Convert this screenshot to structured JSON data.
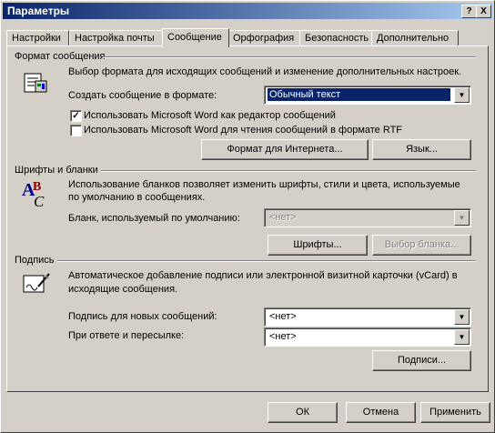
{
  "window": {
    "title": "Параметры",
    "help_button": "?",
    "close_button": "X"
  },
  "tabs": [
    {
      "label": "Настройки"
    },
    {
      "label": "Настройка почты"
    },
    {
      "label": "Сообщение"
    },
    {
      "label": "Орфография"
    },
    {
      "label": "Безопасность"
    },
    {
      "label": "Дополнительно"
    }
  ],
  "active_tab": "Сообщение",
  "format": {
    "header": "Формат сообщения",
    "description": "Выбор формата для исходящих сообщений и изменение дополнительных настроек.",
    "create_label": "Создать сообщение в формате:",
    "create_value": "Обычный текст",
    "use_word_editor": {
      "label": "Использовать Microsoft Word как редактор сообщений",
      "checked": true,
      "mark": "✓"
    },
    "use_word_rtf": {
      "label": "Использовать Microsoft Word для чтения сообщений в формате RTF",
      "checked": false,
      "mark": ""
    },
    "internet_format_button": "Формат для Интернета...",
    "language_button": "Язык..."
  },
  "fonts": {
    "header": "Шрифты и бланки",
    "description_line1": "Использование бланков позволяет изменить шрифты, стили и цвета, используемые",
    "description_line2": "по умолчанию в сообщениях.",
    "stationery_label": "Бланк, используемый по умолчанию:",
    "stationery_value": "<нет>",
    "fonts_button": "Шрифты...",
    "choose_stationery_button": "Выбор бланка..."
  },
  "signature": {
    "header": "Подпись",
    "description_line1": "Автоматическое добавление подписи или электронной визитной карточки (vCard) в",
    "description_line2": "исходящие сообщения.",
    "new_label": "Подпись для новых сообщений:",
    "new_value": "<нет>",
    "reply_label": "При ответе и пересылке:",
    "reply_value": "<нет>",
    "signatures_button": "Подписи..."
  },
  "footer": {
    "ok": "ОК",
    "cancel": "Отмена",
    "apply": "Применить"
  },
  "colors": {
    "titlebar_start": "#0a246a",
    "titlebar_end": "#a6caf0",
    "face": "#d4d0c8",
    "selection": "#0a246a"
  }
}
